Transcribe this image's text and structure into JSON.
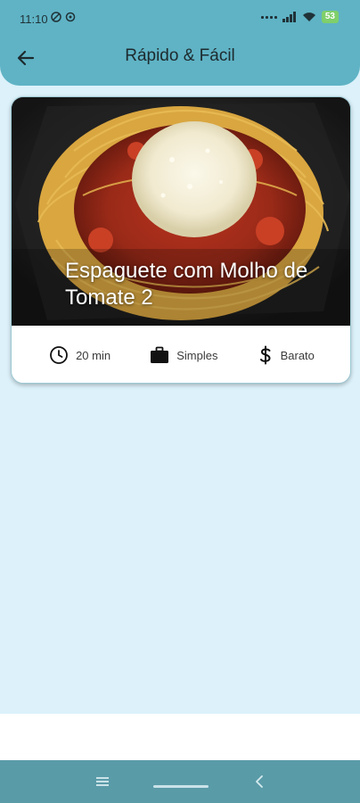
{
  "status_bar": {
    "time": "11:10",
    "battery": "53"
  },
  "app_bar": {
    "title": "Rápido & Fácil"
  },
  "recipe_card": {
    "title": "Espaguete com Molho de Tomate 2",
    "duration": "20 min",
    "complexity": "Simples",
    "cost": "Barato"
  },
  "icons": {
    "back": "arrow-left-icon",
    "clock": "clock-icon",
    "work": "briefcase-icon",
    "cost": "dollar-icon"
  },
  "colors": {
    "app_bar": "#5fb3c5",
    "background": "#dcf1fa",
    "nav_bar": "#5a9ba8"
  }
}
